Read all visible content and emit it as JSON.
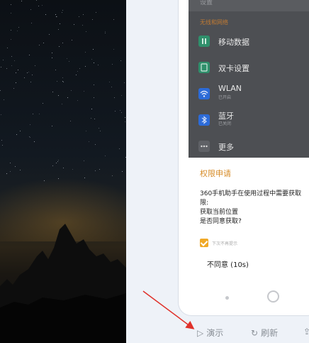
{
  "settings": {
    "top_label": "设置",
    "section_label": "无线和网络",
    "items": [
      {
        "label": "移动数据",
        "sub": "",
        "icon": "mobile-data-icon",
        "color": "#2f8f6b"
      },
      {
        "label": "双卡设置",
        "sub": "",
        "icon": "dual-sim-icon",
        "color": "#2f8f6b"
      },
      {
        "label": "WLAN",
        "sub": "已开启",
        "icon": "wifi-icon",
        "color": "#2c6bd8"
      },
      {
        "label": "蓝牙",
        "sub": "已关闭",
        "icon": "bluetooth-icon",
        "color": "#2c6bd8"
      },
      {
        "label": "更多",
        "sub": "",
        "icon": "more-icon",
        "color": "#5f6166"
      }
    ]
  },
  "dialog": {
    "title": "权限申请",
    "body_lines": [
      "360手机助手在使用过程中需要获取",
      "限:",
      "获取当前位置",
      "是否同意获取?"
    ],
    "checkbox_label": "下次不再提示",
    "disagree_label": "不同意 (10s)"
  },
  "toolbar": {
    "play_label": "演示",
    "refresh_label": "刷新"
  },
  "colors": {
    "accent": "#d68b27",
    "arrow": "#e0312b"
  }
}
